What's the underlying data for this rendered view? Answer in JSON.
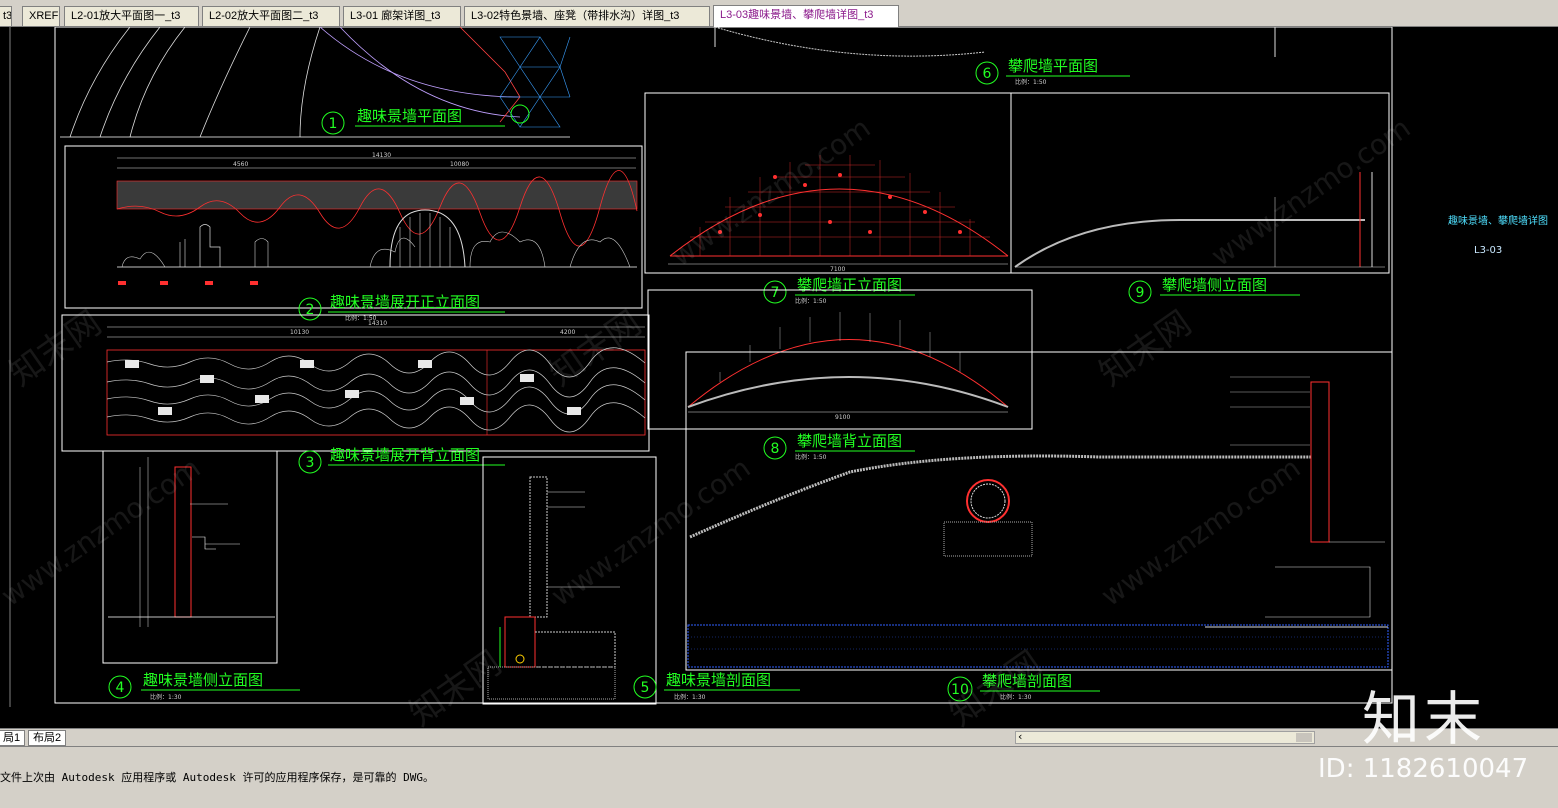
{
  "tabs": [
    {
      "label": "t3"
    },
    {
      "label": "XREF"
    },
    {
      "label": "L2-01放大平面图一_t3"
    },
    {
      "label": "L2-02放大平面图二_t3"
    },
    {
      "label": "L3-01 廊架详图_t3"
    },
    {
      "label": "L3-02特色景墙、座凳（带排水沟）详图_t3"
    },
    {
      "label": "L3-03趣味景墙、攀爬墙详图_t3"
    }
  ],
  "active_tab_index": 6,
  "drawing": {
    "titles": [
      {
        "num": "1",
        "text": "趣味景墙平面图"
      },
      {
        "num": "2",
        "text": "趣味景墙展开正立面图"
      },
      {
        "num": "3",
        "text": "趣味景墙展开背立面图"
      },
      {
        "num": "4",
        "text": "趣味景墙侧立面图"
      },
      {
        "num": "5",
        "text": "趣味景墙剖面图"
      },
      {
        "num": "6",
        "text": "攀爬墙平面图"
      },
      {
        "num": "7",
        "text": "攀爬墙正立面图"
      },
      {
        "num": "8",
        "text": "攀爬墙背立面图"
      },
      {
        "num": "9",
        "text": "攀爬墙侧立面图"
      },
      {
        "num": "10",
        "text": "攀爬墙剖面图"
      }
    ],
    "scales": {
      "s1": "比例：1:50",
      "s2": "比例：1:50",
      "s4": "比例：1:30",
      "s5": "比例：1:30",
      "s6": "比例：1:50",
      "s7": "比例：1:50",
      "s8": "比例：1:50",
      "s10": "比例：1:30"
    },
    "sheet_title": "趣味景墙、攀爬墙详图",
    "sheet_code": "L3-03",
    "dims": {
      "d2_total": "14130",
      "d2_a": "4560",
      "d2_b": "10080",
      "d3_total": "14310",
      "d3_a": "10130",
      "d3_b": "4200",
      "d7_w": "7100",
      "d8_w": "9100"
    },
    "watermarks": [
      "知末网",
      "www.znzmo.com"
    ]
  },
  "layout_tabs": [
    {
      "label": "局1"
    },
    {
      "label": "布局2"
    }
  ],
  "command_line": "文件上次由 Autodesk 应用程序或 Autodesk 许可的应用程序保存，是可靠的 DWG。",
  "brand": {
    "logo": "知末",
    "id": "ID: 1182610047"
  },
  "colors": {
    "background": "#000000",
    "title": "#22ff22",
    "frame": "#ffffff",
    "accent_red": "#ff2020"
  }
}
